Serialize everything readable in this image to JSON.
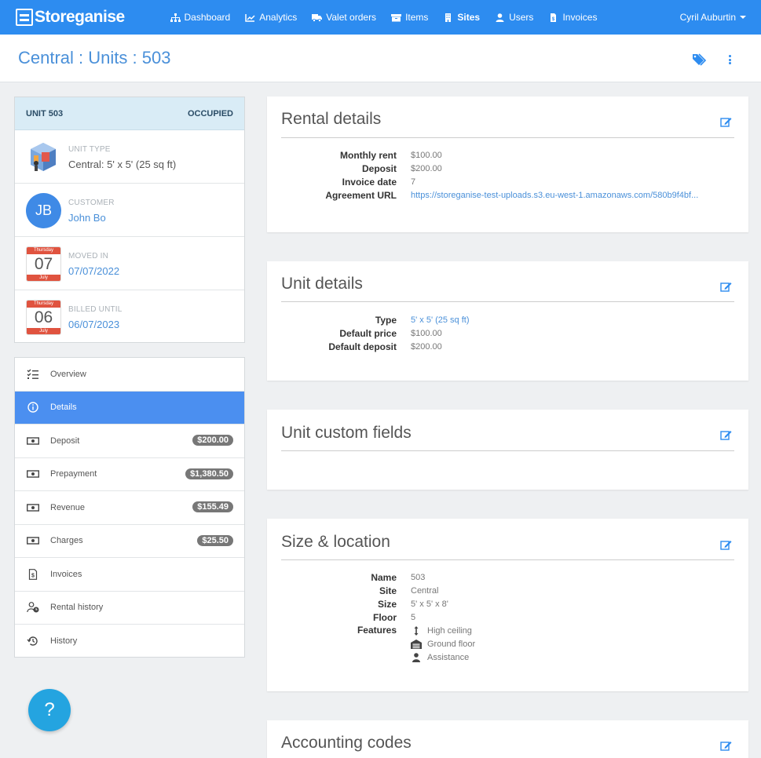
{
  "navbar": {
    "brand": "Storeganise",
    "items": [
      {
        "label": "Dashboard",
        "icon": "sitemap-icon"
      },
      {
        "label": "Analytics",
        "icon": "chart-icon"
      },
      {
        "label": "Valet orders",
        "icon": "truck-icon"
      },
      {
        "label": "Items",
        "icon": "archive-icon"
      },
      {
        "label": "Sites",
        "icon": "building-icon",
        "active": true
      },
      {
        "label": "Users",
        "icon": "user-icon"
      },
      {
        "label": "Invoices",
        "icon": "file-dollar-icon"
      }
    ],
    "user": "Cyril Auburtin"
  },
  "page": {
    "title": "Central : Units : 503"
  },
  "summary": {
    "unit": "UNIT 503",
    "status": "OCCUPIED",
    "unit_type_label": "UNIT TYPE",
    "unit_type_value": "Central: 5' x 5' (25 sq ft)",
    "customer_label": "CUSTOMER",
    "customer_initials": "JB",
    "customer_name": "John Bo",
    "moved_in_label": "MOVED IN",
    "moved_in_weekday": "Thursday",
    "moved_in_day": "07",
    "moved_in_month": "July",
    "moved_in_date": "07/07/2022",
    "billed_label": "BILLED UNTIL",
    "billed_weekday": "Thursday",
    "billed_day": "06",
    "billed_month": "July",
    "billed_date": "06/07/2023"
  },
  "sidenav": [
    {
      "label": "Overview",
      "icon": "checklist-icon",
      "badge": ""
    },
    {
      "label": "Details",
      "icon": "info-icon",
      "badge": "",
      "active": true
    },
    {
      "label": "Deposit",
      "icon": "money-icon",
      "badge": "$200.00"
    },
    {
      "label": "Prepayment",
      "icon": "money-icon",
      "badge": "$1,380.50"
    },
    {
      "label": "Revenue",
      "icon": "money-icon",
      "badge": "$155.49"
    },
    {
      "label": "Charges",
      "icon": "money-icon",
      "badge": "$25.50"
    },
    {
      "label": "Invoices",
      "icon": "invoice-icon",
      "badge": ""
    },
    {
      "label": "Rental history",
      "icon": "user-clock-icon",
      "badge": ""
    },
    {
      "label": "History",
      "icon": "history-icon",
      "badge": ""
    }
  ],
  "help": "?",
  "rental": {
    "title": "Rental details",
    "monthly_rent_label": "Monthly rent",
    "monthly_rent": "$100.00",
    "deposit_label": "Deposit",
    "deposit": "$200.00",
    "invoice_date_label": "Invoice date",
    "invoice_date": "7",
    "agreement_label": "Agreement URL",
    "agreement_url": "https://storeganise-test-uploads.s3.eu-west-1.amazonaws.com/580b9f4bf..."
  },
  "unit_details": {
    "title": "Unit details",
    "type_label": "Type",
    "type": "5' x 5' (25 sq ft)",
    "price_label": "Default price",
    "price": "$100.00",
    "deposit_label": "Default deposit",
    "deposit": "$200.00"
  },
  "custom_fields": {
    "title": "Unit custom fields"
  },
  "size_location": {
    "title": "Size & location",
    "name_label": "Name",
    "name": "503",
    "site_label": "Site",
    "site": "Central",
    "size_label": "Size",
    "size": "5' x 5' x 8'",
    "floor_label": "Floor",
    "floor": "5",
    "features_label": "Features",
    "features": [
      {
        "label": "High ceiling",
        "icon": "arrows-vertical-icon"
      },
      {
        "label": "Ground floor",
        "icon": "garage-icon"
      },
      {
        "label": "Assistance",
        "icon": "person-icon"
      }
    ]
  },
  "accounting": {
    "title": "Accounting codes"
  },
  "colors": {
    "primary": "#2d8cf0",
    "link": "#4a90d9",
    "active_nav": "#4b8ff0",
    "summary_head": "#d9ecf6",
    "calendar_red": "#e0533f"
  }
}
